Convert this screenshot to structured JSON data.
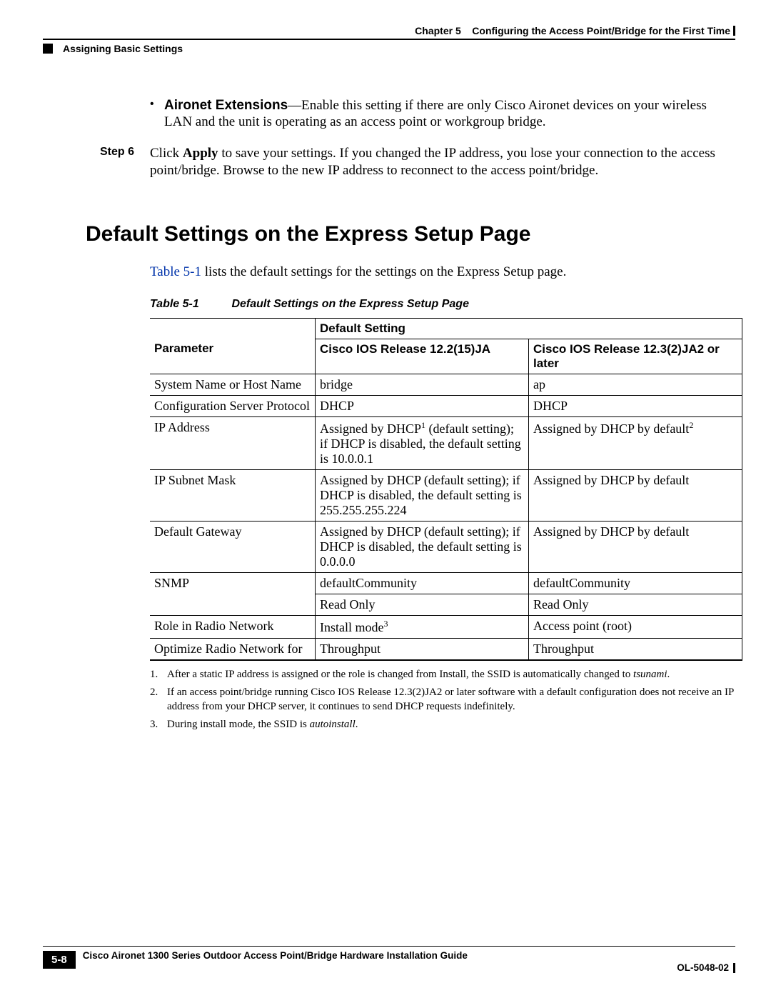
{
  "header": {
    "chapter_label": "Chapter 5",
    "chapter_title": "Configuring the Access Point/Bridge for the First Time",
    "section_title": "Assigning Basic Settings"
  },
  "bullet": {
    "term": "Aironet Extensions",
    "sep": "—",
    "text": "Enable this setting if there are only Cisco Aironet devices on your wireless LAN and the unit is operating as an access point or workgroup bridge."
  },
  "step": {
    "label": "Step 6",
    "prefix": "Click ",
    "bold": "Apply",
    "rest": " to save your settings. If you changed the IP address, you lose your connection to the access point/bridge. Browse to the new IP address to reconnect to the access point/bridge."
  },
  "section_heading": "Default Settings on the Express Setup Page",
  "intro": {
    "link": "Table 5-1",
    "rest": " lists the default settings for the settings on the Express Setup page."
  },
  "table": {
    "caption_num": "Table 5-1",
    "caption_title": "Default Settings on the Express Setup Page",
    "head_top": "Default Setting",
    "head_param": "Parameter",
    "head_col1": "Cisco IOS Release 12.2(15)JA",
    "head_col2": "Cisco IOS Release 12.3(2)JA2 or later",
    "rows": [
      {
        "param": "System Name or Host Name",
        "a": "bridge",
        "a_sup": "",
        "b": "ap",
        "b_sup": ""
      },
      {
        "param": "Configuration Server Protocol",
        "a": "DHCP",
        "a_sup": "",
        "b": "DHCP",
        "b_sup": ""
      },
      {
        "param": "IP Address",
        "a": "Assigned by DHCP",
        "a_sup": "1",
        "a_tail": " (default setting); if DHCP is disabled, the default setting is 10.0.0.1",
        "b": "Assigned by DHCP by default",
        "b_sup": "2",
        "b_tail": ""
      },
      {
        "param": "IP Subnet Mask",
        "a": "Assigned by DHCP (default setting); if DHCP is disabled, the default setting is 255.255.255.224",
        "a_sup": "",
        "b": "Assigned by DHCP by default",
        "b_sup": ""
      },
      {
        "param": "Default Gateway",
        "a": "Assigned by DHCP (default setting); if DHCP is disabled, the default setting is 0.0.0.0",
        "a_sup": "",
        "b": "Assigned by DHCP by default",
        "b_sup": ""
      },
      {
        "param": "SNMP",
        "a": "defaultCommunity",
        "a_sup": "",
        "b": "defaultCommunity",
        "b_sup": ""
      },
      {
        "param": "",
        "a": "Read Only",
        "a_sup": "",
        "b": "Read Only",
        "b_sup": ""
      },
      {
        "param": "Role in Radio Network",
        "a": "Install mode",
        "a_sup": "3",
        "a_tail": "",
        "b": "Access point (root)",
        "b_sup": ""
      },
      {
        "param": "Optimize Radio Network for",
        "a": "Throughput",
        "a_sup": "",
        "b": "Throughput",
        "b_sup": ""
      }
    ],
    "footnotes": [
      {
        "num": "1.",
        "text": "After a static IP address is assigned or the role is changed from Install, the SSID is automatically changed to ",
        "italic": "tsunami",
        "tail": "."
      },
      {
        "num": "2.",
        "text": "If an access point/bridge running Cisco IOS Release 12.3(2)JA2 or later software with a default configuration does not receive an IP address from your DHCP server, it continues to send DHCP requests indefinitely.",
        "italic": "",
        "tail": ""
      },
      {
        "num": "3.",
        "text": "During install mode, the SSID is ",
        "italic": "autoinstall",
        "tail": "."
      }
    ]
  },
  "footer": {
    "guide_title": "Cisco Aironet 1300 Series Outdoor Access Point/Bridge Hardware Installation Guide",
    "page_number": "5-8",
    "doc_id": "OL-5048-02"
  }
}
